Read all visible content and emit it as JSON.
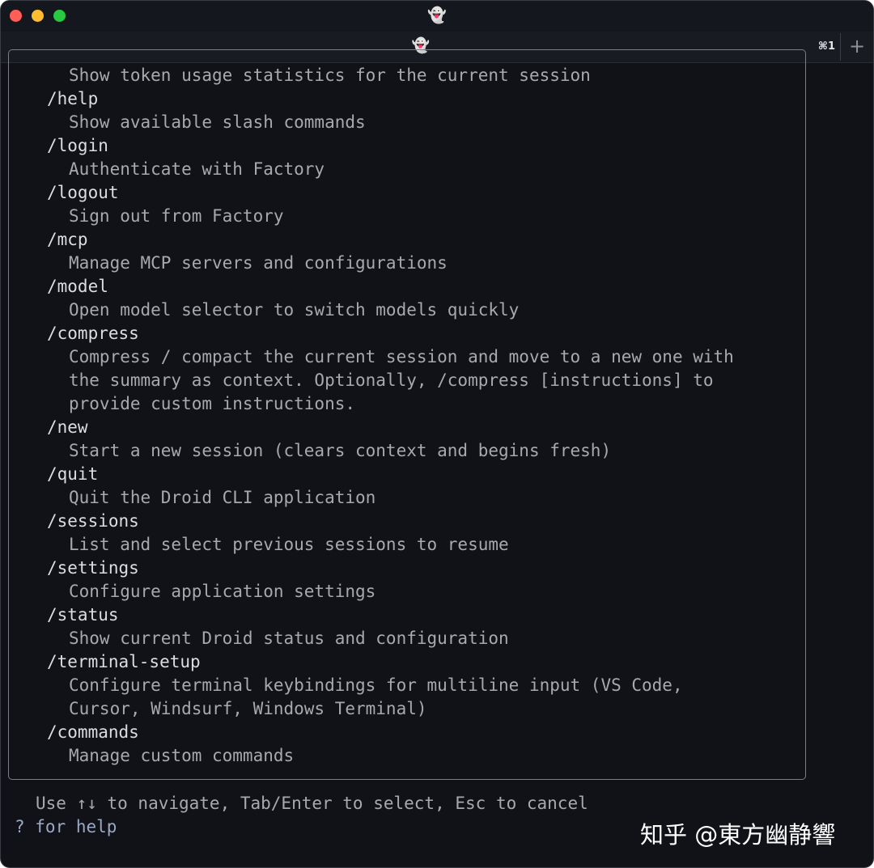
{
  "titlebar": {
    "icon": "👻"
  },
  "tabbar": {
    "tab_icon": "👻",
    "shortcut": "⌘1",
    "new_tab": "+"
  },
  "lines": [
    {
      "type": "desc",
      "text": "Show token usage statistics for the current session"
    },
    {
      "type": "cmd",
      "text": "/help"
    },
    {
      "type": "desc",
      "text": "Show available slash commands"
    },
    {
      "type": "cmd",
      "text": "/login"
    },
    {
      "type": "desc",
      "text": "Authenticate with Factory"
    },
    {
      "type": "cmd",
      "text": "/logout"
    },
    {
      "type": "desc",
      "text": "Sign out from Factory"
    },
    {
      "type": "cmd",
      "text": "/mcp"
    },
    {
      "type": "desc",
      "text": "Manage MCP servers and configurations"
    },
    {
      "type": "cmd",
      "text": "/model"
    },
    {
      "type": "desc",
      "text": "Open model selector to switch models quickly"
    },
    {
      "type": "cmd",
      "text": "/compress"
    },
    {
      "type": "desc",
      "text": "Compress / compact the current session and move to a new one with"
    },
    {
      "type": "desc",
      "text": "the summary as context. Optionally, /compress [instructions] to"
    },
    {
      "type": "desc",
      "text": "provide custom instructions."
    },
    {
      "type": "cmd",
      "text": "/new"
    },
    {
      "type": "desc",
      "text": "Start a new session (clears context and begins fresh)"
    },
    {
      "type": "cmd",
      "text": "/quit"
    },
    {
      "type": "desc",
      "text": "Quit the Droid CLI application"
    },
    {
      "type": "cmd",
      "text": "/sessions"
    },
    {
      "type": "desc",
      "text": "List and select previous sessions to resume"
    },
    {
      "type": "cmd",
      "text": "/settings"
    },
    {
      "type": "desc",
      "text": "Configure application settings"
    },
    {
      "type": "cmd",
      "text": "/status"
    },
    {
      "type": "desc",
      "text": "Show current Droid status and configuration"
    },
    {
      "type": "cmd",
      "text": "/terminal-setup"
    },
    {
      "type": "desc",
      "text": "Configure terminal keybindings for multiline input (VS Code,"
    },
    {
      "type": "desc",
      "text": "Cursor, Windsurf, Windows Terminal)"
    },
    {
      "type": "cmd",
      "text": "/commands"
    },
    {
      "type": "desc",
      "text": "Manage custom commands"
    }
  ],
  "footer": {
    "hint": "Use ↑↓ to navigate, Tab/Enter to select, Esc to cancel",
    "help": "? for help"
  },
  "watermark": "知乎 @東方幽静響"
}
